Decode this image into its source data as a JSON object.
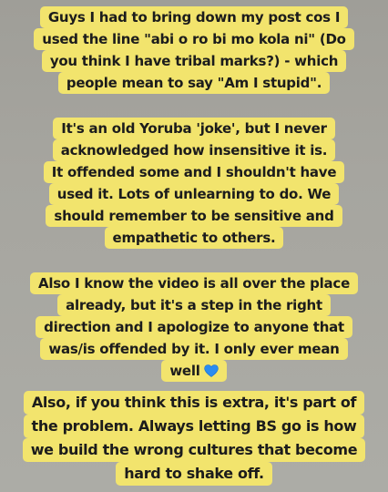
{
  "story": {
    "paragraph1": {
      "lines": [
        "Guys I had to bring down my post cos I",
        "used the line \"abi o ro bi mo kola ni\" (Do",
        "you think I have tribal marks?) - which",
        "people mean to say \"Am I stupid\"."
      ]
    },
    "paragraph2": {
      "lines": [
        "It's an old Yoruba 'joke', but I never",
        "acknowledged how insensitive it is.",
        "It offended some and I shouldn't have",
        "used it. Lots of unlearning to do. We",
        "should remember to be sensitive and",
        "empathetic to others."
      ]
    },
    "paragraph3": {
      "lines": [
        "Also I know the video is all over the place",
        "already, but it's a step in the right",
        "direction and I apologize to anyone that",
        "was/is offended by it. I only ever mean",
        "well"
      ],
      "emoji": "blue-heart-icon"
    },
    "paragraph4": {
      "lines": [
        "Also, if you think this is extra, it's part of",
        "the problem. Always letting BS go is how",
        "we build the wrong cultures that become",
        "hard to shake off."
      ]
    }
  },
  "colors": {
    "background": "#a6a59f",
    "highlight": "#f2e46d",
    "text": "#1c1c1c",
    "heart": "#2b8cf0"
  }
}
